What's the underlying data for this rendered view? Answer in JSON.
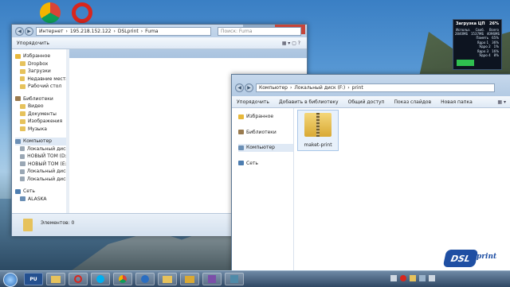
{
  "window1": {
    "address": [
      "Интернет",
      "195.218.152.122",
      "DSLprint",
      "Fuma"
    ],
    "search_placeholder": "Поиск: Fuma",
    "toolbar": [
      "Упорядочить"
    ],
    "nav": [
      {
        "label": "Избранное",
        "icon": "star-icon"
      },
      {
        "label": "Dropbox",
        "icon": "folder-icon"
      },
      {
        "label": "Загрузки",
        "icon": "folder-icon"
      },
      {
        "label": "Недавние места",
        "icon": "folder-icon"
      },
      {
        "label": "Рабочий стол",
        "icon": "folder-icon"
      },
      {
        "label": "Библиотеки",
        "icon": "library-icon"
      },
      {
        "label": "Видео",
        "icon": "folder-icon"
      },
      {
        "label": "Документы",
        "icon": "folder-icon"
      },
      {
        "label": "Изображения",
        "icon": "folder-icon"
      },
      {
        "label": "Музыка",
        "icon": "folder-icon"
      },
      {
        "label": "Компьютер",
        "icon": "computer-icon"
      },
      {
        "label": "Локальный диск",
        "icon": "drive-icon"
      },
      {
        "label": "НОВЫЙ ТОМ (D:)",
        "icon": "drive-icon"
      },
      {
        "label": "НОВЫЙ ТОМ (E:)",
        "icon": "drive-icon"
      },
      {
        "label": "Локальный диск",
        "icon": "drive-icon"
      },
      {
        "label": "Локальный диск",
        "icon": "drive-icon"
      },
      {
        "label": "Сеть",
        "icon": "network-icon"
      },
      {
        "label": "ALASKA",
        "icon": "computer-icon"
      }
    ],
    "status": "Элементов: 0"
  },
  "window2": {
    "address": [
      "Компьютер",
      "Локальный диск (F:)",
      "print"
    ],
    "toolbar": [
      "Упорядочить",
      "Добавить в библиотеку",
      "Общий доступ",
      "Показ слайдов",
      "Новая папка"
    ],
    "nav": [
      {
        "label": "Избранное",
        "icon": "star-icon"
      },
      {
        "label": "Библиотеки",
        "icon": "library-icon"
      },
      {
        "label": "Компьютер",
        "icon": "computer-icon"
      },
      {
        "label": "Сеть",
        "icon": "network-icon"
      }
    ],
    "folder": {
      "name": "maket-print",
      "icon": "zip-folder-icon"
    }
  },
  "gadget": {
    "title": "Загрузка ЦП",
    "percent": "26%",
    "headers": [
      "Использ.",
      "Своб.",
      "Всего"
    ],
    "rows": [
      [
        "2840МБ",
        "1537МБ",
        "4096МБ"
      ],
      [
        "Память",
        "65%"
      ],
      [
        "Ядро 1",
        "36%"
      ],
      [
        "Ядро 2",
        "1%"
      ],
      [
        "Ядро 3",
        "16%"
      ],
      [
        "Ядро 4",
        "8%"
      ]
    ]
  },
  "taskbar": {
    "apps": [
      "start-orb",
      "PU",
      "explorer",
      "opera",
      "skype",
      "chrome",
      "skype-2",
      "folder",
      "folder-2",
      "app",
      "app-2"
    ],
    "logo": "DSL",
    "logo_sub": "print"
  }
}
